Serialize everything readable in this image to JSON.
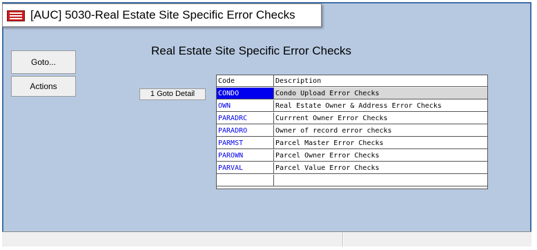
{
  "window": {
    "title": "[AUC] 5030-Real Estate Site Specific Error Checks"
  },
  "app_icon": "app-logo-icon",
  "side_buttons": {
    "goto_label": "Goto...",
    "actions_label": "Actions"
  },
  "page_title": "Real Estate Site Specific Error Checks",
  "goto_detail_label": "1 Goto Detail",
  "grid": {
    "headers": {
      "code": "Code",
      "description": "Description"
    },
    "rows": [
      {
        "code": "CONDO",
        "description": "Condo Upload Error Checks"
      },
      {
        "code": "OWN",
        "description": "Real Estate Owner & Address Error Checks"
      },
      {
        "code": "PARADRC",
        "description": "Currrent Owner Error Checks"
      },
      {
        "code": "PARADRO",
        "description": "Owner of record error checks"
      },
      {
        "code": "PARMST",
        "description": "Parcel Master Error Checks"
      },
      {
        "code": "PAROWN",
        "description": "Parcel Owner Error Checks"
      },
      {
        "code": "PARVAL",
        "description": "Parcel Value Error Checks"
      },
      {
        "code": "",
        "description": ""
      }
    ],
    "selected_index": 0
  },
  "colors": {
    "background": "#b7c9e1",
    "link": "#0000ee",
    "selection": "#0000ee"
  }
}
